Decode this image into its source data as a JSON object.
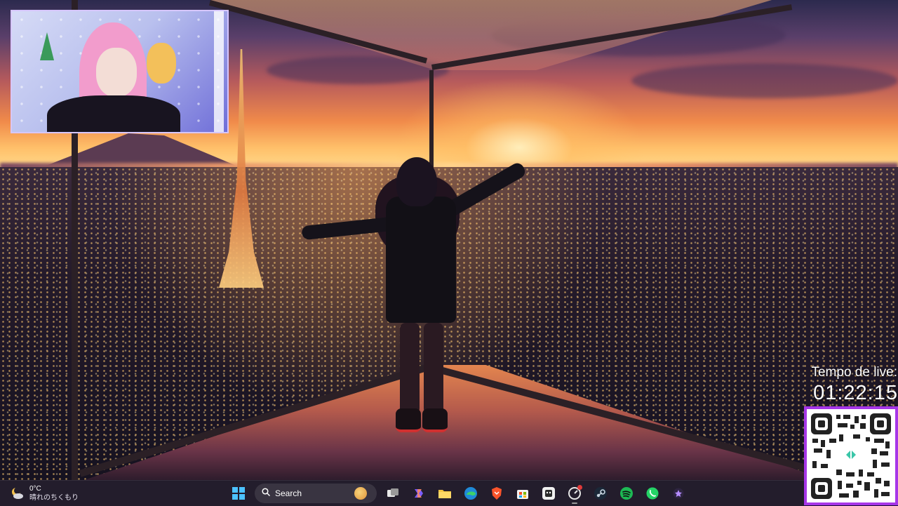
{
  "overlay": {
    "timer_label": "Tempo de live:",
    "timer_value": "01:22:15"
  },
  "weather": {
    "temperature": "0°C",
    "description": "晴れのちくもり"
  },
  "taskbar": {
    "search_label": "Search",
    "apps": [
      {
        "name": "start",
        "icon": "windows-logo-icon"
      },
      {
        "name": "search",
        "icon": "search-icon"
      },
      {
        "name": "task-view",
        "icon": "task-view-icon"
      },
      {
        "name": "copilot",
        "icon": "copilot-icon"
      },
      {
        "name": "file-explorer",
        "icon": "folder-icon"
      },
      {
        "name": "edge",
        "icon": "edge-icon"
      },
      {
        "name": "brave",
        "icon": "brave-icon"
      },
      {
        "name": "store",
        "icon": "store-icon"
      },
      {
        "name": "obs",
        "icon": "obs-icon"
      },
      {
        "name": "capture",
        "icon": "capture-icon"
      },
      {
        "name": "steam",
        "icon": "steam-icon"
      },
      {
        "name": "spotify",
        "icon": "spotify-icon"
      },
      {
        "name": "whatsapp",
        "icon": "whatsapp-icon"
      },
      {
        "name": "extra-app",
        "icon": "app-icon"
      }
    ]
  },
  "colors": {
    "qr_border": "#a636e8",
    "taskbar_bg": "#241e2c",
    "spotify": "#1db954",
    "whatsapp": "#25d366",
    "edge": "#1f8ad8",
    "brave": "#fb542b"
  }
}
